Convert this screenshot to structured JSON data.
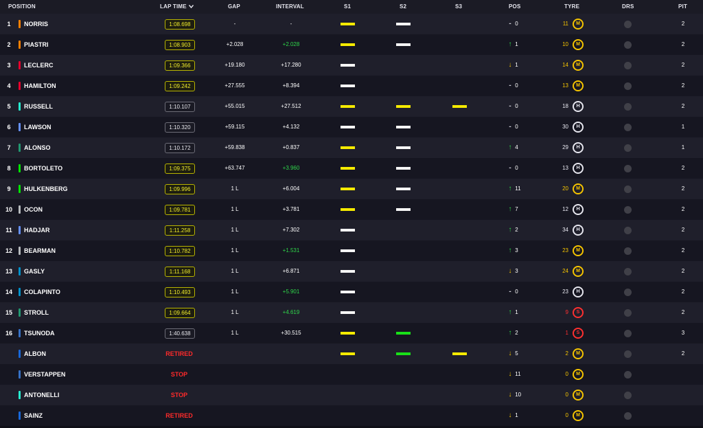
{
  "header": {
    "position": "POSITION",
    "lap_time": "LAP TIME",
    "gap": "GAP",
    "interval": "INTERVAL",
    "s1": "S1",
    "s2": "S2",
    "s3": "S3",
    "pos": "POS",
    "tyre": "TYRE",
    "drs": "DRS",
    "pit": "PIT"
  },
  "colors": {
    "yellow_sector": "#f5ea00",
    "green_sector": "#19e019",
    "white_sector": "#f5f5f5",
    "status_red": "#ff2a2a"
  },
  "rows": [
    {
      "pos": "1",
      "name": "NORRIS",
      "team_color": "#ff8000",
      "lap": "1:08.698",
      "lap_style": "yellow",
      "gap": "-",
      "interval": "-",
      "interval_color": "white",
      "s1": "yellow",
      "s2": "white",
      "s3": "",
      "pos_dir": "none",
      "pos_change": "0",
      "tyre_laps": "11",
      "tyre": "M",
      "tyre_type": "medium",
      "pit": "2"
    },
    {
      "pos": "2",
      "name": "PIASTRI",
      "team_color": "#ff8000",
      "lap": "1:08.903",
      "lap_style": "yellow",
      "gap": "+2.028",
      "interval": "+2.028",
      "interval_color": "green",
      "s1": "yellow",
      "s2": "white",
      "s3": "",
      "pos_dir": "up",
      "pos_change": "1",
      "tyre_laps": "10",
      "tyre": "M",
      "tyre_type": "medium",
      "pit": "2"
    },
    {
      "pos": "3",
      "name": "LECLERC",
      "team_color": "#e8002d",
      "lap": "1:09.366",
      "lap_style": "yellow",
      "gap": "+19.180",
      "interval": "+17.280",
      "interval_color": "white",
      "s1": "white",
      "s2": "",
      "s3": "",
      "pos_dir": "down",
      "pos_change": "1",
      "tyre_laps": "14",
      "tyre": "M",
      "tyre_type": "medium",
      "pit": "2"
    },
    {
      "pos": "4",
      "name": "HAMILTON",
      "team_color": "#e8002d",
      "lap": "1:09.242",
      "lap_style": "yellow",
      "gap": "+27.555",
      "interval": "+8.394",
      "interval_color": "white",
      "s1": "white",
      "s2": "",
      "s3": "",
      "pos_dir": "none",
      "pos_change": "0",
      "tyre_laps": "13",
      "tyre": "M",
      "tyre_type": "medium",
      "pit": "2"
    },
    {
      "pos": "5",
      "name": "RUSSELL",
      "team_color": "#27f4d2",
      "lap": "1:10.107",
      "lap_style": "white",
      "gap": "+55.015",
      "interval": "+27.512",
      "interval_color": "white",
      "s1": "yellow",
      "s2": "yellow",
      "s3": "yellow",
      "pos_dir": "none",
      "pos_change": "0",
      "tyre_laps": "18",
      "tyre": "H",
      "tyre_type": "hard",
      "pit": "2"
    },
    {
      "pos": "6",
      "name": "LAWSON",
      "team_color": "#6692ff",
      "lap": "1:10.320",
      "lap_style": "white",
      "gap": "+59.115",
      "interval": "+4.132",
      "interval_color": "white",
      "s1": "white",
      "s2": "white",
      "s3": "",
      "pos_dir": "none",
      "pos_change": "0",
      "tyre_laps": "30",
      "tyre": "H",
      "tyre_type": "hard",
      "pit": "1"
    },
    {
      "pos": "7",
      "name": "ALONSO",
      "team_color": "#229971",
      "lap": "1:10.172",
      "lap_style": "white",
      "gap": "+59.838",
      "interval": "+0.837",
      "interval_color": "white",
      "s1": "yellow",
      "s2": "white",
      "s3": "",
      "pos_dir": "up",
      "pos_change": "4",
      "tyre_laps": "29",
      "tyre": "H",
      "tyre_type": "hard",
      "pit": "1"
    },
    {
      "pos": "8",
      "name": "BORTOLETO",
      "team_color": "#00e701",
      "lap": "1:09.375",
      "lap_style": "yellow",
      "gap": "+63.747",
      "interval": "+3.960",
      "interval_color": "green",
      "s1": "yellow",
      "s2": "white",
      "s3": "",
      "pos_dir": "none",
      "pos_change": "0",
      "tyre_laps": "13",
      "tyre": "H",
      "tyre_type": "hard",
      "pit": "2"
    },
    {
      "pos": "9",
      "name": "HULKENBERG",
      "team_color": "#00e701",
      "lap": "1:09.996",
      "lap_style": "yellow",
      "gap": "1 L",
      "interval": "+6.004",
      "interval_color": "white",
      "s1": "yellow",
      "s2": "white",
      "s3": "",
      "pos_dir": "up",
      "pos_change": "11",
      "tyre_laps": "20",
      "tyre": "M",
      "tyre_type": "medium",
      "pit": "2"
    },
    {
      "pos": "10",
      "name": "OCON",
      "team_color": "#b6babd",
      "lap": "1:09.781",
      "lap_style": "yellow",
      "gap": "1 L",
      "interval": "+3.781",
      "interval_color": "white",
      "s1": "yellow",
      "s2": "white",
      "s3": "",
      "pos_dir": "up",
      "pos_change": "7",
      "tyre_laps": "12",
      "tyre": "H",
      "tyre_type": "hard",
      "pit": "2"
    },
    {
      "pos": "11",
      "name": "HADJAR",
      "team_color": "#6692ff",
      "lap": "1:11.258",
      "lap_style": "yellow",
      "gap": "1 L",
      "interval": "+7.302",
      "interval_color": "white",
      "s1": "white",
      "s2": "",
      "s3": "",
      "pos_dir": "up",
      "pos_change": "2",
      "tyre_laps": "34",
      "tyre": "H",
      "tyre_type": "hard",
      "pit": "2"
    },
    {
      "pos": "12",
      "name": "BEARMAN",
      "team_color": "#b6babd",
      "lap": "1:10.782",
      "lap_style": "yellow",
      "gap": "1 L",
      "interval": "+1.531",
      "interval_color": "green",
      "s1": "white",
      "s2": "",
      "s3": "",
      "pos_dir": "up",
      "pos_change": "3",
      "tyre_laps": "23",
      "tyre": "M",
      "tyre_type": "medium",
      "pit": "2"
    },
    {
      "pos": "13",
      "name": "GASLY",
      "team_color": "#0093cc",
      "lap": "1:11.168",
      "lap_style": "yellow",
      "gap": "1 L",
      "interval": "+6.871",
      "interval_color": "white",
      "s1": "white",
      "s2": "",
      "s3": "",
      "pos_dir": "down",
      "pos_change": "3",
      "tyre_laps": "24",
      "tyre": "M",
      "tyre_type": "medium",
      "pit": "2"
    },
    {
      "pos": "14",
      "name": "COLAPINTO",
      "team_color": "#0093cc",
      "lap": "1:10.493",
      "lap_style": "yellow",
      "gap": "1 L",
      "interval": "+5.901",
      "interval_color": "green",
      "s1": "white",
      "s2": "",
      "s3": "",
      "pos_dir": "none",
      "pos_change": "0",
      "tyre_laps": "23",
      "tyre": "H",
      "tyre_type": "hard",
      "pit": "2"
    },
    {
      "pos": "15",
      "name": "STROLL",
      "team_color": "#229971",
      "lap": "1:09.664",
      "lap_style": "yellow",
      "gap": "1 L",
      "interval": "+4.619",
      "interval_color": "green",
      "s1": "white",
      "s2": "",
      "s3": "",
      "pos_dir": "up",
      "pos_change": "1",
      "tyre_laps": "9",
      "tyre": "S",
      "tyre_type": "soft",
      "pit": "2"
    },
    {
      "pos": "16",
      "name": "TSUNODA",
      "team_color": "#3671c6",
      "lap": "1:40.638",
      "lap_style": "white",
      "gap": "1 L",
      "interval": "+30.515",
      "interval_color": "white",
      "s1": "yellow",
      "s2": "green",
      "s3": "",
      "pos_dir": "up",
      "pos_change": "2",
      "tyre_laps": "1",
      "tyre": "S",
      "tyre_type": "soft",
      "pit": "3"
    },
    {
      "pos": "",
      "name": "ALBON",
      "team_color": "#1868db",
      "lap": "RETIRED",
      "lap_style": "txt",
      "gap": "",
      "interval": "",
      "interval_color": "white",
      "s1": "yellow",
      "s2": "green",
      "s3": "yellow",
      "pos_dir": "down",
      "pos_change": "5",
      "tyre_laps": "2",
      "tyre": "M",
      "tyre_type": "medium",
      "pit": "2"
    },
    {
      "pos": "",
      "name": "VERSTAPPEN",
      "team_color": "#3671c6",
      "lap": "STOP",
      "lap_style": "txt",
      "gap": "",
      "interval": "",
      "interval_color": "white",
      "s1": "",
      "s2": "",
      "s3": "",
      "pos_dir": "down",
      "pos_change": "11",
      "tyre_laps": "0",
      "tyre": "M",
      "tyre_type": "medium",
      "pit": ""
    },
    {
      "pos": "",
      "name": "ANTONELLI",
      "team_color": "#27f4d2",
      "lap": "STOP",
      "lap_style": "txt",
      "gap": "",
      "interval": "",
      "interval_color": "white",
      "s1": "",
      "s2": "",
      "s3": "",
      "pos_dir": "down",
      "pos_change": "10",
      "tyre_laps": "0",
      "tyre": "M",
      "tyre_type": "medium",
      "pit": ""
    },
    {
      "pos": "",
      "name": "SAINZ",
      "team_color": "#1868db",
      "lap": "RETIRED",
      "lap_style": "txt",
      "gap": "",
      "interval": "",
      "interval_color": "white",
      "s1": "",
      "s2": "",
      "s3": "",
      "pos_dir": "down",
      "pos_change": "1",
      "tyre_laps": "0",
      "tyre": "M",
      "tyre_type": "medium",
      "pit": ""
    }
  ]
}
